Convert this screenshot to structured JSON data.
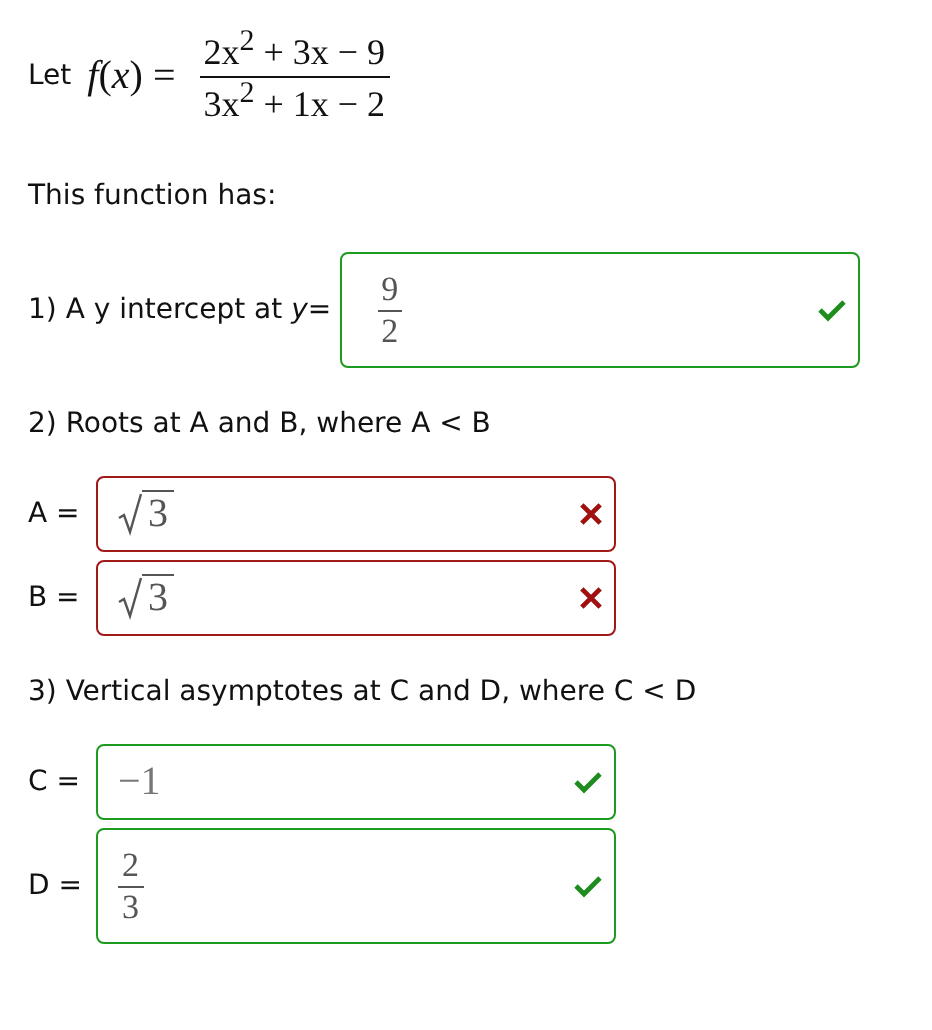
{
  "intro": {
    "label": "Let",
    "function": "*f*(*x*) =",
    "numerator": "2x$^{2}$ + 3x − 9",
    "denominator": "3x$^{2}$ + 1x − 2"
  },
  "lead": "This function has:",
  "questions": [
    {
      "kind": "inline",
      "prompt": "1) A y intercept at *y*=",
      "answers": [
        {
          "kind": "fraction",
          "numerator": "9",
          "denominator": "2",
          "correct": true
        }
      ]
    },
    {
      "kind": "stacked",
      "prompt": "2) Roots at A and B, where A < B",
      "answers": [
        {
          "label": "A =",
          "kind": "sqrt",
          "value": "3",
          "correct": false
        },
        {
          "label": "B =",
          "kind": "sqrt",
          "value": "3",
          "correct": false
        }
      ]
    },
    {
      "kind": "stacked",
      "prompt": "3) Vertical asymptotes at C and D, where C < D",
      "answers": [
        {
          "label": "C =",
          "kind": "plain",
          "value": "−1",
          "correct": true
        },
        {
          "label": "D =",
          "kind": "fraction",
          "numerator": "2",
          "denominator": "3",
          "correct": true
        }
      ]
    }
  ]
}
